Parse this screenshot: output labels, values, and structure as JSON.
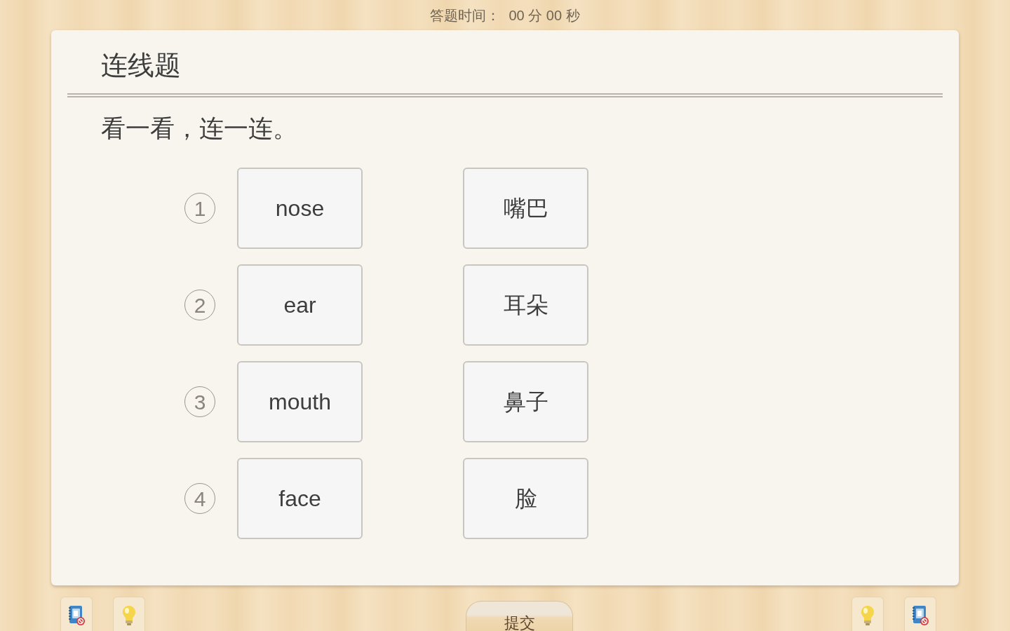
{
  "timer": {
    "label": "答题时间：",
    "value": "00 分 00 秒"
  },
  "question": {
    "type": "连线题",
    "instruction": "看一看，连一连。",
    "rows": [
      {
        "number": "1",
        "left": "nose",
        "right": "嘴巴"
      },
      {
        "number": "2",
        "left": "ear",
        "right": "耳朵"
      },
      {
        "number": "3",
        "left": "mouth",
        "right": "鼻子"
      },
      {
        "number": "4",
        "left": "face",
        "right": "脸"
      }
    ]
  },
  "toolbar": {
    "left_buttons": [
      {
        "kind": "notebook"
      },
      {
        "kind": "hint"
      }
    ],
    "submit": "提交",
    "right_buttons": [
      {
        "kind": "hint"
      },
      {
        "kind": "notebook"
      }
    ]
  }
}
